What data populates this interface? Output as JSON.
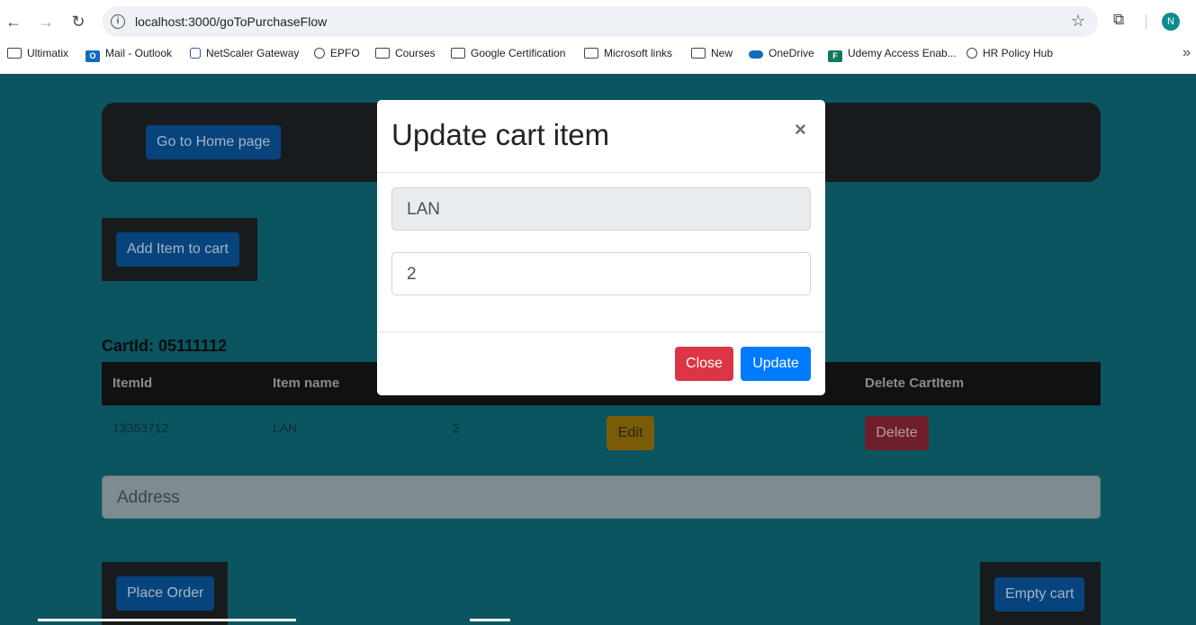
{
  "browser": {
    "url": "localhost:3000/goToPurchaseFlow",
    "profile_initial": "N",
    "bookmarks": [
      {
        "label": "Ultimatix",
        "icon": "folder-icon"
      },
      {
        "label": "Mail - Outlook",
        "icon": "outlook-icon"
      },
      {
        "label": "NetScaler Gateway",
        "icon": "lock-icon"
      },
      {
        "label": "EPFO",
        "icon": "globe-icon"
      },
      {
        "label": "Courses",
        "icon": "folder-icon"
      },
      {
        "label": "Google Certification",
        "icon": "folder-icon"
      },
      {
        "label": "Microsoft links",
        "icon": "folder-icon"
      },
      {
        "label": "New",
        "icon": "folder-icon"
      },
      {
        "label": "OneDrive",
        "icon": "cloud-icon"
      },
      {
        "label": "Udemy Access Enab...",
        "icon": "forms-icon"
      },
      {
        "label": "HR Policy Hub",
        "icon": "globe-icon"
      }
    ]
  },
  "page": {
    "home_button": "Go to Home page",
    "add_item_button": "Add Item to cart",
    "cart_id_label": "CartId: 05111112",
    "table": {
      "headers": [
        "ItemId",
        "Item name",
        "",
        "",
        "Delete CartItem"
      ],
      "rows": [
        {
          "item_id": "13353712",
          "item_name": "LAN",
          "quantity": "2",
          "edit_label": "Edit",
          "delete_label": "Delete"
        }
      ]
    },
    "address_placeholder": "Address",
    "place_order_button": "Place Order",
    "empty_cart_button": "Empty cart"
  },
  "modal": {
    "title": "Update cart item",
    "close_symbol": "×",
    "item_name_value": "LAN",
    "quantity_value": "2",
    "close_button": "Close",
    "update_button": "Update"
  },
  "colors": {
    "page_bg": "#0b5560",
    "primary": "#007bff",
    "danger": "#dc3545",
    "warning": "#ffc107"
  }
}
